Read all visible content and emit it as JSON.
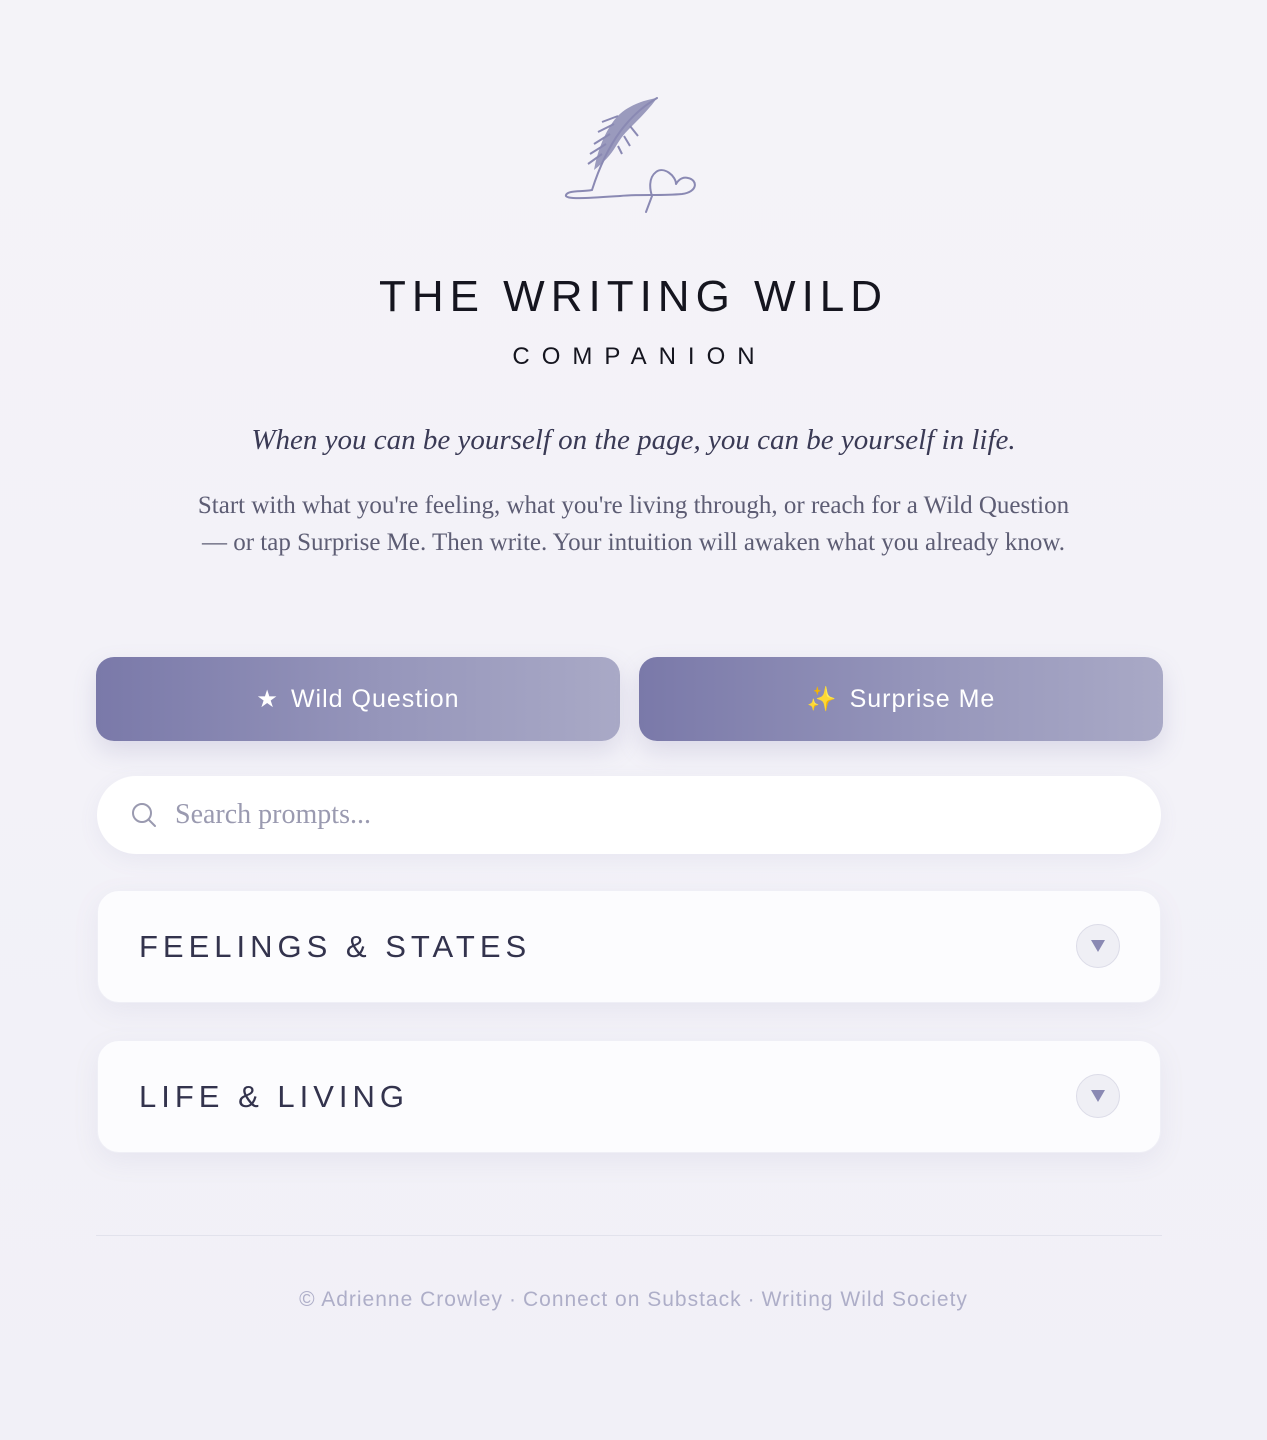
{
  "header": {
    "title": "THE WRITING WILD",
    "subtitle": "COMPANION",
    "tagline": "When you can be yourself on the page, you can be yourself in life.",
    "intro": "Start with what you're feeling, what you're living through, or reach for a Wild Question — or tap Surprise Me. Then write. Your intuition will awaken what you already know."
  },
  "actions": {
    "wild_question": {
      "icon": "★",
      "label": "Wild Question"
    },
    "surprise_me": {
      "icon": "✨",
      "label": "Surprise Me"
    }
  },
  "search": {
    "placeholder": "Search prompts...",
    "value": ""
  },
  "categories": [
    {
      "label": "FEELINGS & STATES",
      "icon": "chevron-down-icon"
    },
    {
      "label": "LIFE & LIVING",
      "icon": "chevron-down-icon"
    }
  ],
  "footer": {
    "copyright": "© Adrienne Crowley",
    "separator": "·",
    "link_substack": "Connect on Substack",
    "link_society": "Writing Wild Society"
  },
  "colors": {
    "accent": "#8a89b3",
    "button_gradient_start": "#7a79a9",
    "button_gradient_end": "#a9a9c6",
    "text_dark": "#15151f",
    "text_muted": "#5d5d74"
  }
}
